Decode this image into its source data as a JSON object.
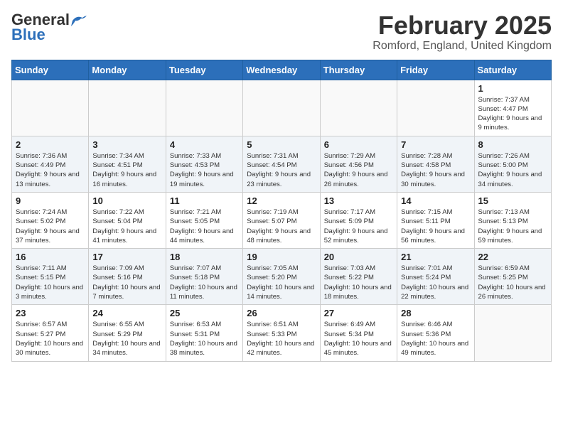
{
  "header": {
    "logo_general": "General",
    "logo_blue": "Blue",
    "month_title": "February 2025",
    "subtitle": "Romford, England, United Kingdom"
  },
  "weekdays": [
    "Sunday",
    "Monday",
    "Tuesday",
    "Wednesday",
    "Thursday",
    "Friday",
    "Saturday"
  ],
  "weeks": [
    [
      {
        "day": "",
        "info": ""
      },
      {
        "day": "",
        "info": ""
      },
      {
        "day": "",
        "info": ""
      },
      {
        "day": "",
        "info": ""
      },
      {
        "day": "",
        "info": ""
      },
      {
        "day": "",
        "info": ""
      },
      {
        "day": "1",
        "info": "Sunrise: 7:37 AM\nSunset: 4:47 PM\nDaylight: 9 hours and 9 minutes."
      }
    ],
    [
      {
        "day": "2",
        "info": "Sunrise: 7:36 AM\nSunset: 4:49 PM\nDaylight: 9 hours and 13 minutes."
      },
      {
        "day": "3",
        "info": "Sunrise: 7:34 AM\nSunset: 4:51 PM\nDaylight: 9 hours and 16 minutes."
      },
      {
        "day": "4",
        "info": "Sunrise: 7:33 AM\nSunset: 4:53 PM\nDaylight: 9 hours and 19 minutes."
      },
      {
        "day": "5",
        "info": "Sunrise: 7:31 AM\nSunset: 4:54 PM\nDaylight: 9 hours and 23 minutes."
      },
      {
        "day": "6",
        "info": "Sunrise: 7:29 AM\nSunset: 4:56 PM\nDaylight: 9 hours and 26 minutes."
      },
      {
        "day": "7",
        "info": "Sunrise: 7:28 AM\nSunset: 4:58 PM\nDaylight: 9 hours and 30 minutes."
      },
      {
        "day": "8",
        "info": "Sunrise: 7:26 AM\nSunset: 5:00 PM\nDaylight: 9 hours and 34 minutes."
      }
    ],
    [
      {
        "day": "9",
        "info": "Sunrise: 7:24 AM\nSunset: 5:02 PM\nDaylight: 9 hours and 37 minutes."
      },
      {
        "day": "10",
        "info": "Sunrise: 7:22 AM\nSunset: 5:04 PM\nDaylight: 9 hours and 41 minutes."
      },
      {
        "day": "11",
        "info": "Sunrise: 7:21 AM\nSunset: 5:05 PM\nDaylight: 9 hours and 44 minutes."
      },
      {
        "day": "12",
        "info": "Sunrise: 7:19 AM\nSunset: 5:07 PM\nDaylight: 9 hours and 48 minutes."
      },
      {
        "day": "13",
        "info": "Sunrise: 7:17 AM\nSunset: 5:09 PM\nDaylight: 9 hours and 52 minutes."
      },
      {
        "day": "14",
        "info": "Sunrise: 7:15 AM\nSunset: 5:11 PM\nDaylight: 9 hours and 56 minutes."
      },
      {
        "day": "15",
        "info": "Sunrise: 7:13 AM\nSunset: 5:13 PM\nDaylight: 9 hours and 59 minutes."
      }
    ],
    [
      {
        "day": "16",
        "info": "Sunrise: 7:11 AM\nSunset: 5:15 PM\nDaylight: 10 hours and 3 minutes."
      },
      {
        "day": "17",
        "info": "Sunrise: 7:09 AM\nSunset: 5:16 PM\nDaylight: 10 hours and 7 minutes."
      },
      {
        "day": "18",
        "info": "Sunrise: 7:07 AM\nSunset: 5:18 PM\nDaylight: 10 hours and 11 minutes."
      },
      {
        "day": "19",
        "info": "Sunrise: 7:05 AM\nSunset: 5:20 PM\nDaylight: 10 hours and 14 minutes."
      },
      {
        "day": "20",
        "info": "Sunrise: 7:03 AM\nSunset: 5:22 PM\nDaylight: 10 hours and 18 minutes."
      },
      {
        "day": "21",
        "info": "Sunrise: 7:01 AM\nSunset: 5:24 PM\nDaylight: 10 hours and 22 minutes."
      },
      {
        "day": "22",
        "info": "Sunrise: 6:59 AM\nSunset: 5:25 PM\nDaylight: 10 hours and 26 minutes."
      }
    ],
    [
      {
        "day": "23",
        "info": "Sunrise: 6:57 AM\nSunset: 5:27 PM\nDaylight: 10 hours and 30 minutes."
      },
      {
        "day": "24",
        "info": "Sunrise: 6:55 AM\nSunset: 5:29 PM\nDaylight: 10 hours and 34 minutes."
      },
      {
        "day": "25",
        "info": "Sunrise: 6:53 AM\nSunset: 5:31 PM\nDaylight: 10 hours and 38 minutes."
      },
      {
        "day": "26",
        "info": "Sunrise: 6:51 AM\nSunset: 5:33 PM\nDaylight: 10 hours and 42 minutes."
      },
      {
        "day": "27",
        "info": "Sunrise: 6:49 AM\nSunset: 5:34 PM\nDaylight: 10 hours and 45 minutes."
      },
      {
        "day": "28",
        "info": "Sunrise: 6:46 AM\nSunset: 5:36 PM\nDaylight: 10 hours and 49 minutes."
      },
      {
        "day": "",
        "info": ""
      }
    ]
  ]
}
